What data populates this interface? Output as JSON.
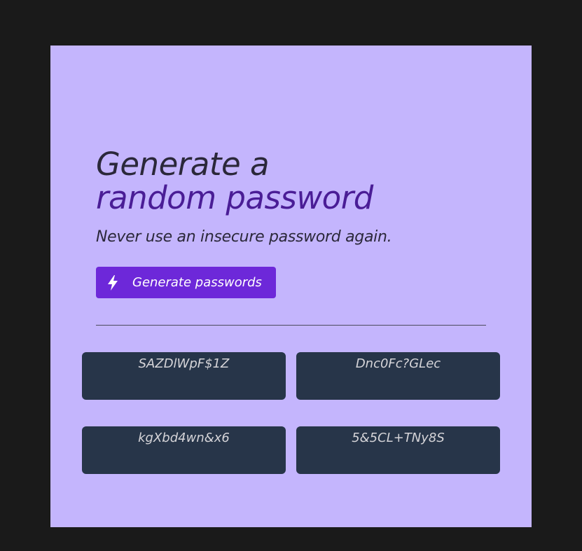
{
  "hero": {
    "title_line1": "Generate a",
    "title_line2": "random password",
    "subtitle": "Never use an insecure password again."
  },
  "generate_button": {
    "label": "Generate passwords",
    "icon": "lightning-bolt-icon"
  },
  "passwords": [
    "SAZDlWpF$1Z",
    "Dnc0Fc?GLec",
    "kgXbd4wn&x6",
    "5&5CL+TNy8S"
  ],
  "colors": {
    "page_background": "#1a1a1a",
    "card_background": "#c4b5fd",
    "heading": "#2b283a",
    "accent_heading": "#4a1d96",
    "button": "#6d28d9",
    "password_box": "#273549",
    "password_text": "#d5d4d8"
  }
}
